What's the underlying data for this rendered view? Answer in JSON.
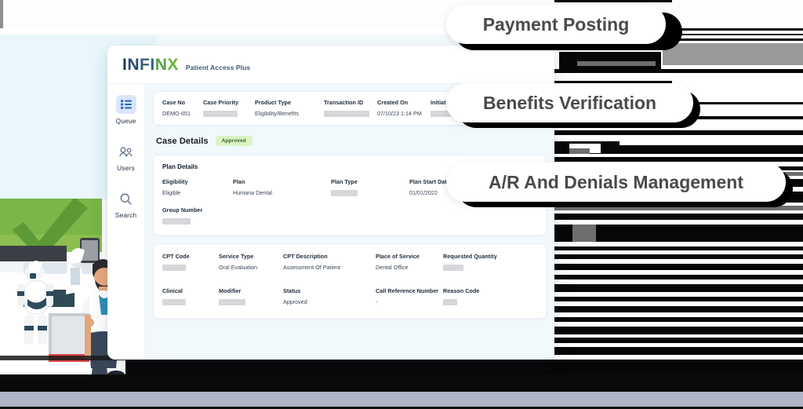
{
  "app": {
    "logo": {
      "text_part1": "INFI",
      "text_part2": "NX",
      "tagline": "Patient Access Plus"
    },
    "sidebar": {
      "items": [
        {
          "label": "Queue",
          "icon": "list-icon",
          "active": true
        },
        {
          "label": "Users",
          "icon": "users-icon",
          "active": false
        },
        {
          "label": "Search",
          "icon": "search-icon",
          "active": false
        }
      ]
    },
    "case_strip": {
      "fields": [
        {
          "label": "Case No",
          "value": "DEMO-651",
          "redacted": false
        },
        {
          "label": "Case Priority",
          "value": "",
          "redacted": true
        },
        {
          "label": "Product Type",
          "value": "Eligibility/Benefits",
          "redacted": false
        },
        {
          "label": "Transaction ID",
          "value": "",
          "redacted": true
        },
        {
          "label": "Created On",
          "value": "07/10/23 1:14 PM",
          "redacted": false
        },
        {
          "label": "Initiation Date",
          "value": "",
          "redacted": true
        }
      ]
    },
    "case_details": {
      "title": "Case Details",
      "status_badge": "Approved"
    },
    "plan_details": {
      "title": "Plan Details",
      "row1": [
        {
          "label": "Eligibility",
          "value": "Eligible",
          "redacted": false
        },
        {
          "label": "Plan",
          "value": "Humana Dental",
          "redacted": false
        },
        {
          "label": "Plan Type",
          "value": "",
          "redacted": true
        },
        {
          "label": "Plan Start Date",
          "value": "01/01/2022",
          "redacted": false
        }
      ],
      "row2": [
        {
          "label": "Group Number",
          "value": "",
          "redacted": true
        }
      ]
    },
    "cpt_details": {
      "row1": [
        {
          "label": "CPT Code",
          "value": "",
          "redacted": true
        },
        {
          "label": "Service Type",
          "value": "Oral Evaluation",
          "redacted": false
        },
        {
          "label": "CPT Description",
          "value": "Assessment Of Patient",
          "redacted": false
        },
        {
          "label": "Place of Service",
          "value": "Dental Office",
          "redacted": false
        },
        {
          "label": "Requested Quantity",
          "value": "",
          "redacted": true
        }
      ],
      "row2": [
        {
          "label": "Clinical",
          "value": "",
          "redacted": true
        },
        {
          "label": "Modifier",
          "value": "",
          "redacted": true
        },
        {
          "label": "Status",
          "value": "Approved",
          "redacted": false
        },
        {
          "label": "Call Reference Number",
          "value": "-",
          "redacted": false
        },
        {
          "label": "Reason Code",
          "value": "",
          "redacted": true
        }
      ]
    }
  },
  "callouts": [
    {
      "label": "Payment Posting"
    },
    {
      "label": "Benefits Verification"
    },
    {
      "label": "A/R And Denials Management"
    }
  ],
  "colors": {
    "accent_blue": "#d9e6fb",
    "logo_navy": "#1f3a63",
    "logo_green": "#6cb33f",
    "badge_green_bg": "#d8f5c2",
    "panel_bg": "#f2f9fd",
    "left_panel_blue": "#e9f7fb",
    "check_green": "#6cb33f",
    "bottom_band": "#aeb4c6"
  }
}
